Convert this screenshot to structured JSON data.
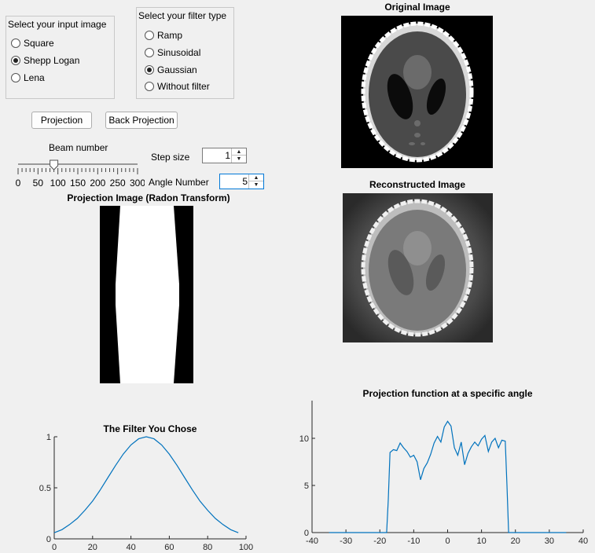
{
  "input_panel": {
    "title": "Select your input image",
    "options": [
      {
        "label": "Square",
        "selected": false
      },
      {
        "label": "Shepp Logan",
        "selected": true
      },
      {
        "label": "Lena",
        "selected": false
      }
    ]
  },
  "filter_panel": {
    "title": "Select your filter type",
    "options": [
      {
        "label": "Ramp",
        "selected": false
      },
      {
        "label": "Sinusoidal",
        "selected": false
      },
      {
        "label": "Gaussian",
        "selected": true
      },
      {
        "label": "Without filter",
        "selected": false
      }
    ]
  },
  "buttons": {
    "projection": "Projection",
    "back_projection": "Back Projection"
  },
  "beam": {
    "label": "Beam number",
    "min": 0,
    "max": 300,
    "value": 90,
    "ticks": [
      "0",
      "50",
      "100",
      "150",
      "200",
      "250",
      "300"
    ]
  },
  "step": {
    "label": "Step size",
    "value": "1"
  },
  "angle": {
    "label": "Angle Number",
    "value": "5"
  },
  "titles": {
    "original": "Original Image",
    "reconstructed": "Reconstructed Image",
    "projection_image": "Projection Image (Radon Transform)"
  },
  "colors": {
    "line": "#0072bd",
    "background": "#f0f0f0",
    "focus": "#0078d7"
  },
  "chart_data": [
    {
      "type": "line",
      "title": "The Filter You Chose",
      "xlabel": "",
      "ylabel": "",
      "xlim": [
        0,
        100
      ],
      "ylim": [
        0,
        1
      ],
      "xticks": [
        0,
        20,
        40,
        60,
        80,
        100
      ],
      "yticks": [
        0,
        0.5,
        1
      ],
      "ytick_labels": [
        "0",
        "0.5",
        "1"
      ],
      "grid": false,
      "series": [
        {
          "x": [
            0,
            4,
            8,
            12,
            16,
            20,
            24,
            28,
            32,
            36,
            40,
            44,
            48,
            52,
            56,
            60,
            64,
            68,
            72,
            76,
            80,
            84,
            88,
            92,
            96
          ],
          "values": [
            0.06,
            0.09,
            0.14,
            0.2,
            0.28,
            0.37,
            0.48,
            0.6,
            0.72,
            0.83,
            0.92,
            0.98,
            1.0,
            0.98,
            0.92,
            0.83,
            0.72,
            0.6,
            0.48,
            0.37,
            0.28,
            0.2,
            0.14,
            0.09,
            0.06
          ]
        }
      ]
    },
    {
      "type": "line",
      "title": "Projection function at a specific angle",
      "xlabel": "",
      "ylabel": "",
      "xlim": [
        -40,
        40
      ],
      "ylim": [
        0,
        14
      ],
      "xticks": [
        -40,
        -30,
        -20,
        -10,
        0,
        10,
        20,
        30,
        40
      ],
      "yticks": [
        0,
        5,
        10
      ],
      "ytick_labels": [
        "0",
        "5",
        "10"
      ],
      "grid": false,
      "series": [
        {
          "x": [
            -35,
            -20,
            -18.5,
            -18,
            -17.5,
            -17,
            -16,
            -15,
            -14,
            -13,
            -12,
            -11,
            -10,
            -9,
            -8,
            -7,
            -6,
            -5,
            -4,
            -3,
            -2,
            -1,
            0,
            1,
            2,
            3,
            4,
            5,
            6,
            7,
            8,
            9,
            10,
            11,
            12,
            13,
            14,
            15,
            16,
            17,
            17.5,
            18,
            20,
            35
          ],
          "values": [
            0,
            0,
            0,
            0,
            3.5,
            8.5,
            8.8,
            8.7,
            9.5,
            9.0,
            8.6,
            8.0,
            8.2,
            7.5,
            5.6,
            6.8,
            7.4,
            8.3,
            9.5,
            10.2,
            9.6,
            11.2,
            11.8,
            11.3,
            9.0,
            8.2,
            9.6,
            7.2,
            8.4,
            9.1,
            9.6,
            9.2,
            9.9,
            10.3,
            8.6,
            9.6,
            10.0,
            9.0,
            9.8,
            9.7,
            5.0,
            0,
            0,
            0
          ]
        }
      ]
    }
  ]
}
